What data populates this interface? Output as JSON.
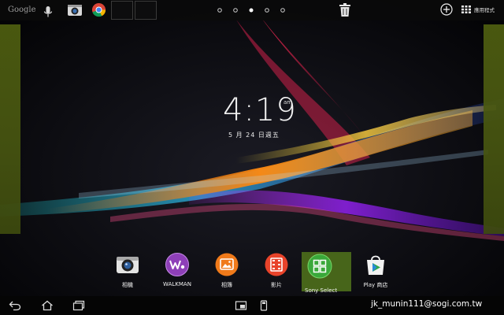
{
  "top_bar": {
    "search_label": "Google",
    "apps_label": "應用程式",
    "page_count": 5,
    "current_page": 3
  },
  "clock": {
    "time": "4:19",
    "ampm": "am",
    "date": "5 月 24 日週五"
  },
  "dock": [
    {
      "label": "相機",
      "icon": "camera-icon"
    },
    {
      "label": "WALKMAN",
      "icon": "walkman-icon"
    },
    {
      "label": "相簿",
      "icon": "album-icon"
    },
    {
      "label": "影片",
      "icon": "movies-icon"
    },
    {
      "label": "Sony Select",
      "icon": "sony-select-icon"
    },
    {
      "label": "Play 商店",
      "icon": "play-store-icon"
    }
  ],
  "watermark": "jk_munin111@sogi.com.tw",
  "colors": {
    "edge_panel": "#4b5a10",
    "sony_select_highlight": "#47651a",
    "bar_background": "#0a0a0a"
  }
}
